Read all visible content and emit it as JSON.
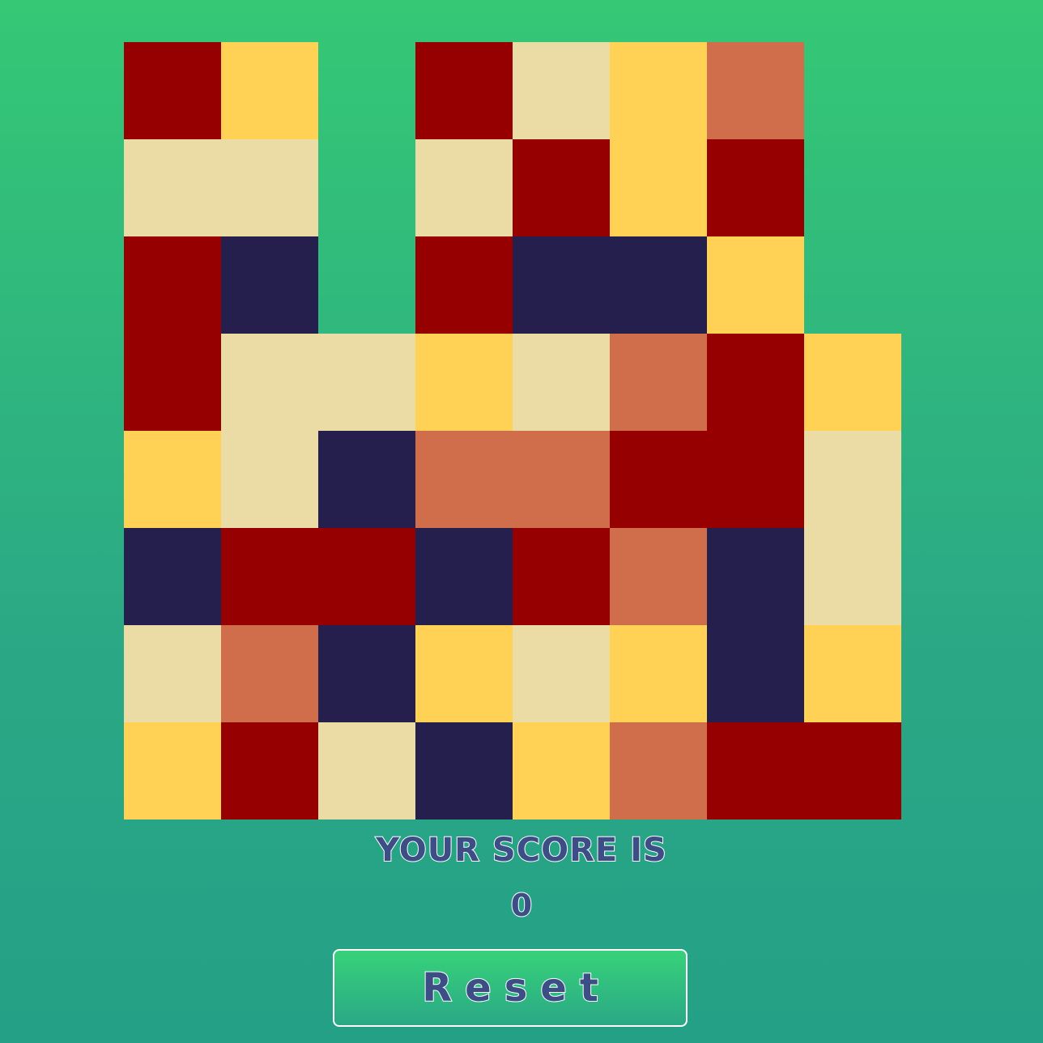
{
  "board": {
    "columns": 8,
    "rows": 8,
    "colors": {
      "R": "#970000",
      "Y": "#ffd154",
      "B": "#ebdca6",
      "O": "#d06d4b",
      "N": "#241f4d"
    },
    "grid": [
      [
        "R",
        "Y",
        "",
        "R",
        "B",
        "Y",
        "O",
        ""
      ],
      [
        "B",
        "B",
        "",
        "B",
        "R",
        "Y",
        "R",
        ""
      ],
      [
        "R",
        "N",
        "",
        "R",
        "N",
        "N",
        "Y",
        ""
      ],
      [
        "R",
        "B",
        "B",
        "Y",
        "B",
        "O",
        "R",
        "Y"
      ],
      [
        "Y",
        "B",
        "N",
        "O",
        "O",
        "R",
        "R",
        "B"
      ],
      [
        "N",
        "R",
        "R",
        "N",
        "R",
        "O",
        "N",
        "B"
      ],
      [
        "B",
        "O",
        "N",
        "Y",
        "B",
        "Y",
        "N",
        "Y"
      ],
      [
        "Y",
        "R",
        "B",
        "N",
        "Y",
        "O",
        "R",
        "R"
      ]
    ]
  },
  "score": {
    "label": "YOUR SCORE IS",
    "value": "0"
  },
  "reset_button": {
    "label": "Reset"
  }
}
